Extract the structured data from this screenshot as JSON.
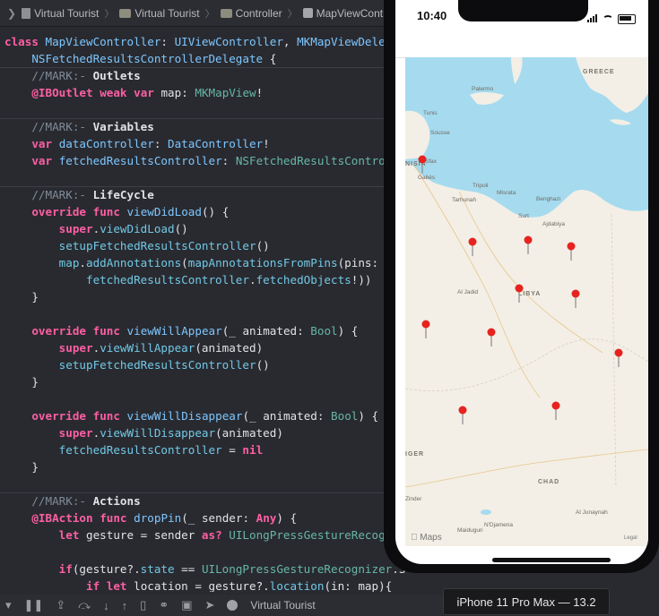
{
  "breadcrumb": {
    "items": [
      "Virtual Tourist",
      "Virtual Tourist",
      "Controller",
      "MapViewControll"
    ]
  },
  "code": {
    "lines": [
      "class MapViewController: UIViewController, MKMapViewDeleg",
      "    NSFetchedResultsControllerDelegate {",
      "    //MARK:- Outlets",
      "    @IBOutlet weak var map: MKMapView!",
      "",
      "    //MARK:- Variables",
      "    var dataController: DataController!",
      "    var fetchedResultsController: NSFetchedResultsControll",
      "",
      "    //MARK:- LifeCycle",
      "    override func viewDidLoad() {",
      "        super.viewDidLoad()",
      "        setupFetchedResultsController()",
      "        map.addAnnotations(mapAnnotationsFromPins(pins:",
      "            fetchedResultsController.fetchedObjects!))",
      "    }",
      "",
      "    override func viewWillAppear(_ animated: Bool) {",
      "        super.viewWillAppear(animated)",
      "        setupFetchedResultsController()",
      "    }",
      "",
      "    override func viewWillDisappear(_ animated: Bool) {",
      "        super.viewWillDisappear(animated)",
      "        fetchedResultsController = nil",
      "    }",
      "",
      "    //MARK:- Actions",
      "    @IBAction func dropPin(_ sender: Any) {",
      "        let gesture = sender as? UILongPressGestureRecogn",
      "",
      "        if(gesture?.state == UILongPressGestureRecognizer.S",
      "            if let location = gesture?.location(in: map){"
    ]
  },
  "simulator": {
    "time": "10:40",
    "map": {
      "countries": [
        "GREECE",
        "LIBYA",
        "CHAD",
        "IGER"
      ],
      "countries_partial_note": "",
      "places": [
        "Palermo",
        "Tunis",
        "Sousse",
        "Tripoli",
        "Misrata",
        "Benghazi",
        "Tarhunah",
        "Surt",
        "Ajdabiya",
        "Al Jadid",
        "Zinder",
        "N'Djamena",
        "Maiduguri",
        "Al Junaynah",
        "NISIA",
        "Sfax",
        "Gabès"
      ],
      "attribution": "Maps",
      "legal": "Legal",
      "pins_count": 12
    }
  },
  "device_label": "iPhone 11 Pro Max — 13.2",
  "debugbar": {
    "scheme": "Virtual Tourist"
  }
}
